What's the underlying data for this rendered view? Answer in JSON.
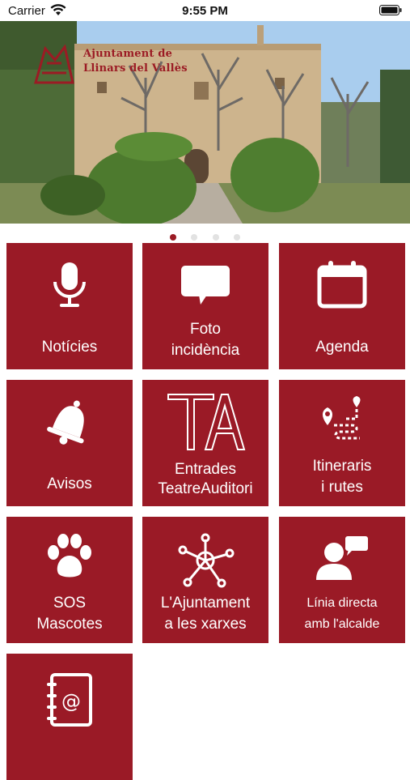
{
  "status_bar": {
    "carrier": "Carrier",
    "time": "9:55 PM"
  },
  "banner": {
    "logo_line1": "Ajuntament de",
    "logo_line2": "Llinars del Vallès",
    "brand_color": "#9b1b24"
  },
  "pager": {
    "count": 4,
    "active_index": 0
  },
  "tiles": [
    {
      "line1": "Notícies",
      "line2": "",
      "icon": "microphone-icon"
    },
    {
      "line1": "Foto",
      "line2": "incidència",
      "icon": "speech-bubble-icon"
    },
    {
      "line1": "Agenda",
      "line2": "",
      "icon": "calendar-icon"
    },
    {
      "line1": "Avisos",
      "line2": "",
      "icon": "bell-icon"
    },
    {
      "line1": "Entrades",
      "line2": "TeatreAuditori",
      "icon": "ta-logo-icon"
    },
    {
      "line1": "Itineraris",
      "line2": "i rutes",
      "icon": "route-map-icon"
    },
    {
      "line1": "SOS",
      "line2": "Mascotes",
      "icon": "paw-icon"
    },
    {
      "line1": "L'Ajuntament",
      "line2": "a les xarxes",
      "icon": "network-icon"
    },
    {
      "line1": "Línia directa",
      "line2": "amb l'alcalde",
      "icon": "chat-person-icon"
    },
    {
      "line1": "",
      "line2": "",
      "icon": "address-book-icon"
    }
  ],
  "colors": {
    "tile_bg": "#9a1a26",
    "dot_inactive": "#e2e2e2"
  }
}
